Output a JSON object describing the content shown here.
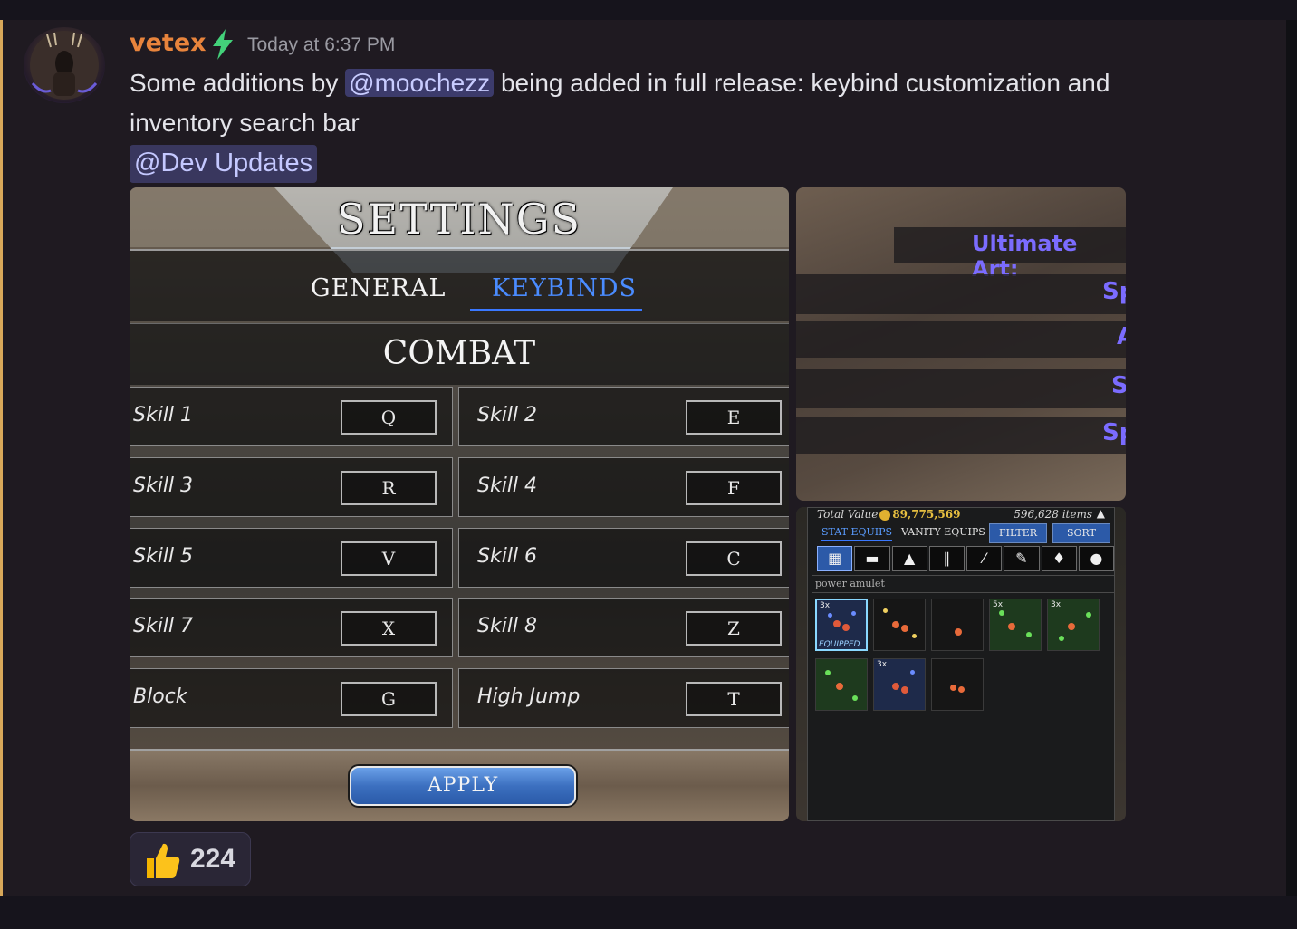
{
  "message": {
    "username": "vetex",
    "timestamp": "Today at 6:37 PM",
    "text_before_mention": "Some additions by ",
    "mention": "@moochezz",
    "text_after_mention": " being added in full release: keybind customization and",
    "text_line2": "inventory search bar",
    "role_mention": "@Dev Updates",
    "colors": {
      "username": "#e8843c",
      "mention_bg": "#3c3b6b",
      "accent": "#d8a85a"
    }
  },
  "settings_screenshot": {
    "title": "SETTINGS",
    "tabs": [
      {
        "label": "GENERAL",
        "active": false
      },
      {
        "label": "KEYBINDS",
        "active": true
      }
    ],
    "section": "COMBAT",
    "keybinds": [
      {
        "label": "Skill 1",
        "key": "Q"
      },
      {
        "label": "Skill 2",
        "key": "E"
      },
      {
        "label": "Skill 3",
        "key": "R"
      },
      {
        "label": "Skill 4",
        "key": "F"
      },
      {
        "label": "Skill 5",
        "key": "V"
      },
      {
        "label": "Skill 6",
        "key": "C"
      },
      {
        "label": "Skill 7",
        "key": "X"
      },
      {
        "label": "Skill 8",
        "key": "Z"
      },
      {
        "label": "Block",
        "key": "G"
      },
      {
        "label": "High Jump",
        "key": "T"
      }
    ],
    "apply_label": "APPLY"
  },
  "ultimate_screenshot": {
    "heading": "Ultimate Art:",
    "partial_labels": [
      "Sp",
      "A",
      "S",
      "Sp"
    ]
  },
  "inventory_screenshot": {
    "total_value_label": "Total Value",
    "total_value": "89,775,569",
    "item_count": "596,628 items",
    "tabs": [
      "STAT EQUIPS",
      "VANITY EQUIPS"
    ],
    "buttons": [
      "FILTER",
      "SORT"
    ],
    "category_icons": [
      "grid-icon",
      "hat-icon",
      "chest-armor-icon",
      "pants-icon",
      "sword-icon",
      "wrench-icon",
      "gem-icon",
      "apple-icon"
    ],
    "search_value": "power amulet",
    "slots": [
      {
        "badge": "3x",
        "equipped_label": "EQUIPPED",
        "style": "blue-red"
      },
      {
        "badge": "",
        "equipped_label": "",
        "style": "gold-sparkle"
      },
      {
        "badge": "",
        "equipped_label": "",
        "style": "plain"
      },
      {
        "badge": "5x",
        "equipped_label": "",
        "style": "green"
      },
      {
        "badge": "3x",
        "equipped_label": "",
        "style": "green"
      },
      {
        "badge": "",
        "equipped_label": "",
        "style": "green"
      },
      {
        "badge": "3x",
        "equipped_label": "",
        "style": "blue-red"
      },
      {
        "badge": "",
        "equipped_label": "",
        "style": "plain-triple"
      }
    ]
  },
  "reaction": {
    "emoji": "thumbs-up-icon",
    "count": "224"
  }
}
